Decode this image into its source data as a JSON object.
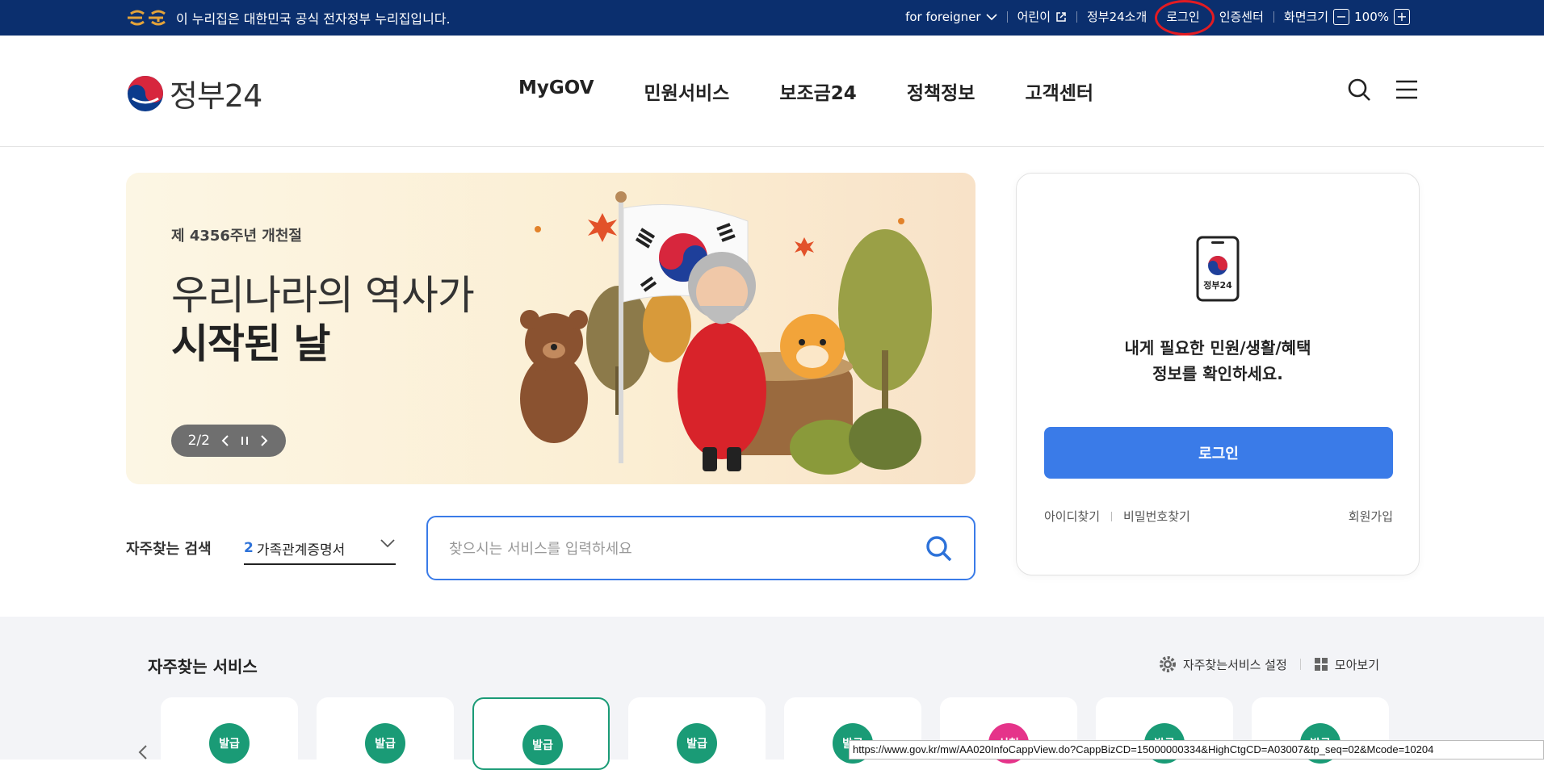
{
  "topbar": {
    "notice": "이 누리집은 대한민국 공식 전자정부 누리집입니다.",
    "links": [
      {
        "label": "for foreigner"
      },
      {
        "label": "어린이"
      },
      {
        "label": "정부24소개"
      },
      {
        "label": "로그인"
      },
      {
        "label": "인증센터"
      },
      {
        "label": "화면크기"
      }
    ],
    "zoom_minus": "−",
    "zoom_level": "100%",
    "zoom_plus": "+",
    "bg_color": "#0b2f6e"
  },
  "header": {
    "logo_text": "정부24",
    "nav": [
      "MyGOV",
      "민원서비스",
      "보조금24",
      "정책정보",
      "고객센터"
    ],
    "icons": [
      "search-icon",
      "menu-icon"
    ]
  },
  "banner": {
    "subtitle": "제 4356주년 개천절",
    "title_line1": "우리나라의 역사가",
    "title_line2": "시작된 날",
    "pager": "2/2"
  },
  "login_box": {
    "phone_label": "정부24",
    "message_line1": "내게 필요한 민원/생활/혜택",
    "message_line2": "정보를 확인하세요.",
    "login_button": "로그인",
    "find_id": "아이디찾기",
    "find_pw": "비밀번호찾기",
    "join": "회원가입",
    "accent_color": "#3a7be8"
  },
  "search": {
    "freq_label": "자주찾는 검색",
    "freq_rank": "2",
    "freq_value": "가족관계증명서",
    "placeholder": "찾으시는 서비스를 입력하세요"
  },
  "services": {
    "title": "자주찾는 서비스",
    "settings": "자주찾는서비스 설정",
    "view_all": "모아보기",
    "cards": [
      {
        "badge": "발급"
      },
      {
        "badge": "발급"
      },
      {
        "badge": "발급"
      },
      {
        "badge": "발급"
      },
      {
        "badge": "발급"
      },
      {
        "badge": "신청"
      },
      {
        "badge": "발급"
      },
      {
        "badge": "발급"
      }
    ]
  },
  "status_url": "https://www.gov.kr/mw/AA020InfoCappView.do?CappBizCD=15000000334&HighCtgCD=A03007&tp_seq=02&Mcode=10204"
}
